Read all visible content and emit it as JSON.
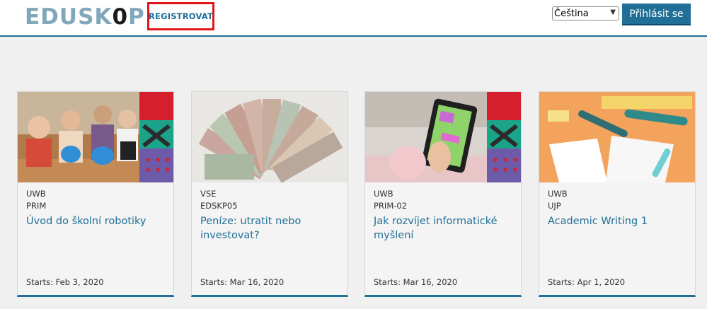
{
  "header": {
    "logo_prefix": "EDUSK",
    "logo_zero": "0",
    "logo_suffix": "P",
    "register_label": "REGISTROVAT",
    "language_selected": "Čeština",
    "login_label": "Přihlásit se"
  },
  "courses": [
    {
      "org": "UWB",
      "code": "PRIM",
      "title": "Úvod do školní robotiky",
      "starts": "Starts: Feb 3, 2020"
    },
    {
      "org": "VSE",
      "code": "EDSKP05",
      "title": "Peníze: utratit nebo investovat?",
      "starts": "Starts: Mar 16, 2020"
    },
    {
      "org": "UWB",
      "code": "PRIM-02",
      "title": "Jak rozvíjet informatické myšlení",
      "starts": "Starts: Mar 16, 2020"
    },
    {
      "org": "UWB",
      "code": "UJP",
      "title": "Academic Writing 1",
      "starts": "Starts: Apr 1, 2020"
    }
  ],
  "colors": {
    "accent": "#1f6f96",
    "highlight_border": "#e4141b"
  }
}
